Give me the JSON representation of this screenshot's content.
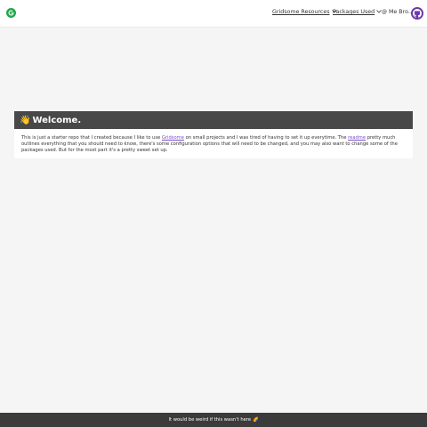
{
  "header": {
    "nav": [
      {
        "label": "Gridsome Resources"
      },
      {
        "label": "Packages Used"
      },
      {
        "label": "Me Bro.."
      }
    ]
  },
  "icons": {
    "logo": "gridsome-logo-icon",
    "github": "github-icon",
    "me": "at-icon",
    "welcome": "waving-hand-icon",
    "footer": "rainbow-icon"
  },
  "colors": {
    "logo": "#23a74a",
    "github": "#6a3aa8",
    "link": "#7a4fc9",
    "card_header": "#484848",
    "footer": "#3b3b3b",
    "background": "#f5f5f5"
  },
  "main": {
    "title": "Welcome.",
    "body": {
      "part1": "This is just a starter repo that I created because I like to use ",
      "link1": "Gridsome",
      "part2": " on small projects and I was tired of having to set it up everytime. The ",
      "link2": "readme",
      "part3": " pretty much outlines everything that you should need to know, there's some configuration options that will need to be changed, and you may also want to change some of the packages used. But for the most part it's a pretty sweet set up."
    }
  },
  "footer": {
    "text": "It would be weird if this wasn't here"
  }
}
